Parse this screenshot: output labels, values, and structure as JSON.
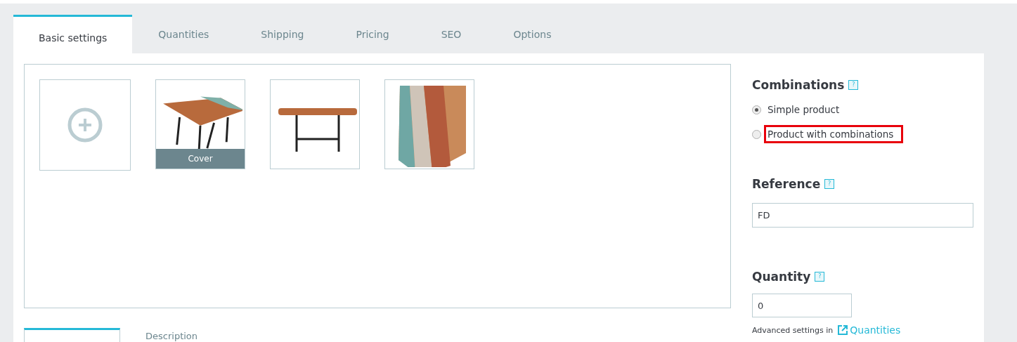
{
  "tabs": [
    {
      "label": "Basic settings",
      "selected": true
    },
    {
      "label": "Quantities",
      "selected": false
    },
    {
      "label": "Shipping",
      "selected": false
    },
    {
      "label": "Pricing",
      "selected": false
    },
    {
      "label": "SEO",
      "selected": false
    },
    {
      "label": "Options",
      "selected": false
    }
  ],
  "images": [
    {
      "kind": "add"
    },
    {
      "kind": "photo",
      "cover": "Cover"
    },
    {
      "kind": "photo"
    },
    {
      "kind": "photo"
    }
  ],
  "combinations": {
    "heading": "Combinations",
    "help": "?",
    "options": [
      {
        "label": "Simple product",
        "selected": true,
        "highlighted": false
      },
      {
        "label": "Product with combinations",
        "selected": false,
        "highlighted": true
      }
    ]
  },
  "reference": {
    "heading": "Reference",
    "help": "?",
    "value": "FD"
  },
  "quantity": {
    "heading": "Quantity",
    "help": "?",
    "value": "0",
    "note": "Advanced settings in",
    "link": "Quantities"
  },
  "bottom_tabs": [
    {
      "selected": true
    },
    {
      "label": "Description",
      "selected": false
    }
  ]
}
